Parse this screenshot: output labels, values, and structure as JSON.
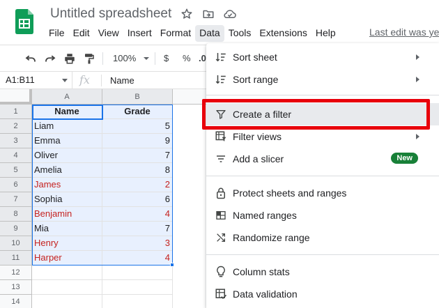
{
  "header": {
    "title": "Untitled spreadsheet",
    "last_edit": "Last edit was ye",
    "icons": [
      "star-icon",
      "move-to-folder-icon",
      "cloud-status-icon"
    ]
  },
  "menubar": {
    "items": [
      "File",
      "Edit",
      "View",
      "Insert",
      "Format",
      "Data",
      "Tools",
      "Extensions",
      "Help"
    ],
    "active": "Data"
  },
  "toolbar": {
    "zoom": "100%",
    "currency": "$",
    "percent": "%",
    "decimal": ".0"
  },
  "formula_bar": {
    "name_box": "A1:B11",
    "fx": "fx",
    "value": "Name"
  },
  "grid": {
    "columns": [
      "A",
      "B"
    ],
    "rows": [
      "1",
      "2",
      "3",
      "4",
      "5",
      "6",
      "7",
      "8",
      "9",
      "10",
      "11",
      "12",
      "13",
      "14"
    ],
    "header_row": [
      "Name",
      "Grade"
    ],
    "data": [
      {
        "name": "Liam",
        "grade": "5"
      },
      {
        "name": "Emma",
        "grade": "9"
      },
      {
        "name": "Oliver",
        "grade": "7"
      },
      {
        "name": "Amelia",
        "grade": "8"
      },
      {
        "name": "James",
        "grade": "2"
      },
      {
        "name": "Sophia",
        "grade": "6"
      },
      {
        "name": "Benjamin",
        "grade": "4"
      },
      {
        "name": "Mia",
        "grade": "7"
      },
      {
        "name": "Henry",
        "grade": "3"
      },
      {
        "name": "Harper",
        "grade": "4"
      }
    ],
    "low_grade_color": "#c5221f",
    "selection_color": "#e8f0fe",
    "selection_border_color": "#1a73e8"
  },
  "data_menu": {
    "items": [
      {
        "label": "Sort sheet",
        "icon": "sort-icon",
        "submenu": true
      },
      {
        "label": "Sort range",
        "icon": "sort-icon",
        "submenu": true
      },
      {
        "label": "Create a filter",
        "icon": "filter-icon",
        "highlighted": true
      },
      {
        "label": "Filter views",
        "icon": "filter-views-icon",
        "submenu": true
      },
      {
        "label": "Add a slicer",
        "icon": "slicer-icon",
        "badge": "New"
      },
      {
        "label": "Protect sheets and ranges",
        "icon": "lock-icon"
      },
      {
        "label": "Named ranges",
        "icon": "named-ranges-icon"
      },
      {
        "label": "Randomize range",
        "icon": "shuffle-icon"
      },
      {
        "label": "Column stats",
        "icon": "lightbulb-icon"
      },
      {
        "label": "Data validation",
        "icon": "data-validation-icon"
      }
    ],
    "badge_color": "#188038",
    "highlight_box_color": "#e8000b"
  }
}
